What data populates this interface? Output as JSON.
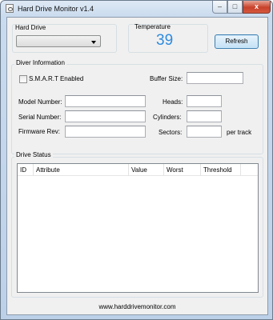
{
  "window": {
    "title": "Hard Drive Monitor v1.4",
    "controls": {
      "minimize": "–",
      "maximize": "□",
      "close": "x"
    }
  },
  "hard_drive": {
    "label": "Hard Drive",
    "selected": ""
  },
  "temperature": {
    "label": "Temperature",
    "value": "39"
  },
  "refresh_label": "Refresh",
  "driver_info": {
    "group_title": "Diver Information",
    "smart_label": "S.M.A.R.T Enabled",
    "smart_checked": false,
    "buffer_size_label": "Buffer Size:",
    "model_number_label": "Model Number:",
    "serial_number_label": "Serial Number:",
    "firmware_rev_label": "Firmware Rev:",
    "heads_label": "Heads:",
    "cylinders_label": "Cylinders:",
    "sectors_label": "Sectors:",
    "per_track_label": "per track",
    "values": {
      "buffer_size": "",
      "model_number": "",
      "serial_number": "",
      "firmware_rev": "",
      "heads": "",
      "cylinders": "",
      "sectors": ""
    }
  },
  "drive_status": {
    "group_title": "Drive Status",
    "columns": [
      "ID",
      "Attribute",
      "Value",
      "Worst",
      "Threshold"
    ],
    "rows": []
  },
  "footer": {
    "url": "www.harddrivemonitor.com"
  },
  "colors": {
    "temperature": "#2c8be0",
    "close_button": "#c7422a",
    "button_border": "#3c7fb1",
    "client_bg": "#f0f0f0"
  }
}
